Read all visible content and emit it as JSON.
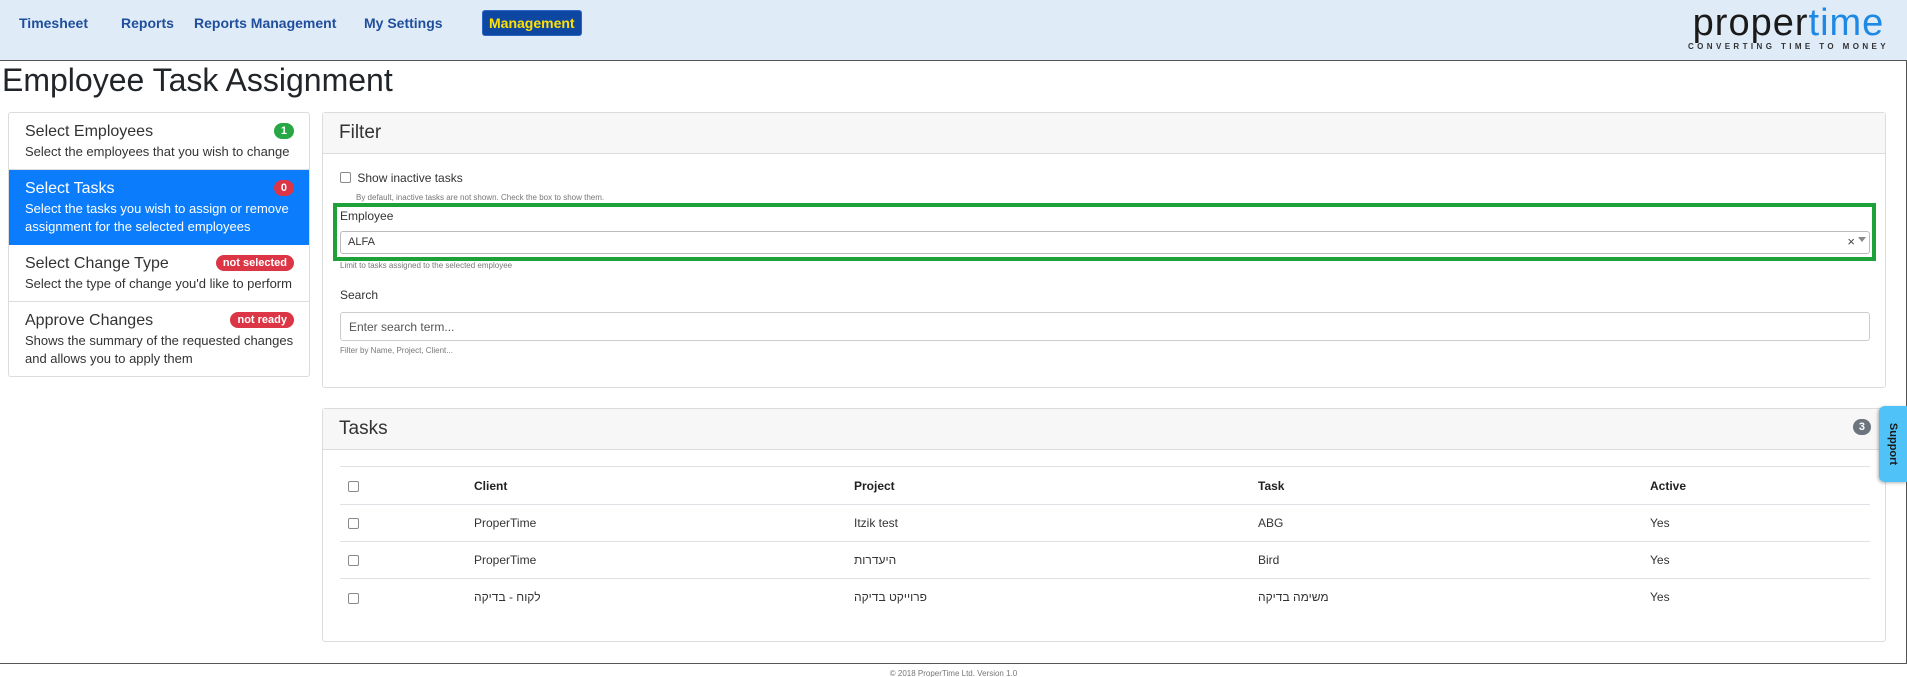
{
  "nav": {
    "items": [
      {
        "label": "Timesheet"
      },
      {
        "label": "Reports"
      },
      {
        "label": "Reports Management"
      },
      {
        "label": "My Settings"
      },
      {
        "label": "Management"
      }
    ],
    "logo_part1": "proper",
    "logo_part2": "time",
    "logo_tagline": "CONVERTING TIME TO MONEY"
  },
  "page_title": "Employee Task Assignment",
  "steps": [
    {
      "title": "Select Employees",
      "badge": "1",
      "desc": "Select the employees that you wish to change"
    },
    {
      "title": "Select Tasks",
      "badge": "0",
      "desc": "Select the tasks you wish to assign or remove assignment for the selected employees"
    },
    {
      "title": "Select Change Type",
      "badge": "not selected",
      "desc": "Select the type of change you'd like to perform"
    },
    {
      "title": "Approve Changes",
      "badge": "not ready",
      "desc": "Shows the summary of the requested changes and allows you to apply them"
    }
  ],
  "filter": {
    "title": "Filter",
    "show_inactive_label": "Show inactive tasks",
    "show_inactive_hint": "By default, inactive tasks are not shown. Check the box to show them.",
    "employee_label": "Employee",
    "employee_value": "ALFA",
    "employee_clear": "×",
    "employee_hint": "Limit to tasks assigned to the selected employee",
    "search_label": "Search",
    "search_placeholder": "Enter search term...",
    "search_hint": "Filter by Name, Project, Client..."
  },
  "tasks": {
    "title": "Tasks",
    "count": "3",
    "columns": [
      "Client",
      "Project",
      "Task",
      "Active"
    ],
    "rows": [
      {
        "client": "ProperTime",
        "project": "Itzik test",
        "task": "ABG",
        "active": "Yes"
      },
      {
        "client": "ProperTime",
        "project": "היעדרות",
        "task": "Bird",
        "active": "Yes"
      },
      {
        "client": "לקוח - בדיקה",
        "project": "פרוייקט בדיקה",
        "task": "משימה בדיקה",
        "active": "Yes"
      }
    ]
  },
  "support_label": "Support",
  "footer_text": "© 2018 ProperTime Ltd. Version 1.0"
}
